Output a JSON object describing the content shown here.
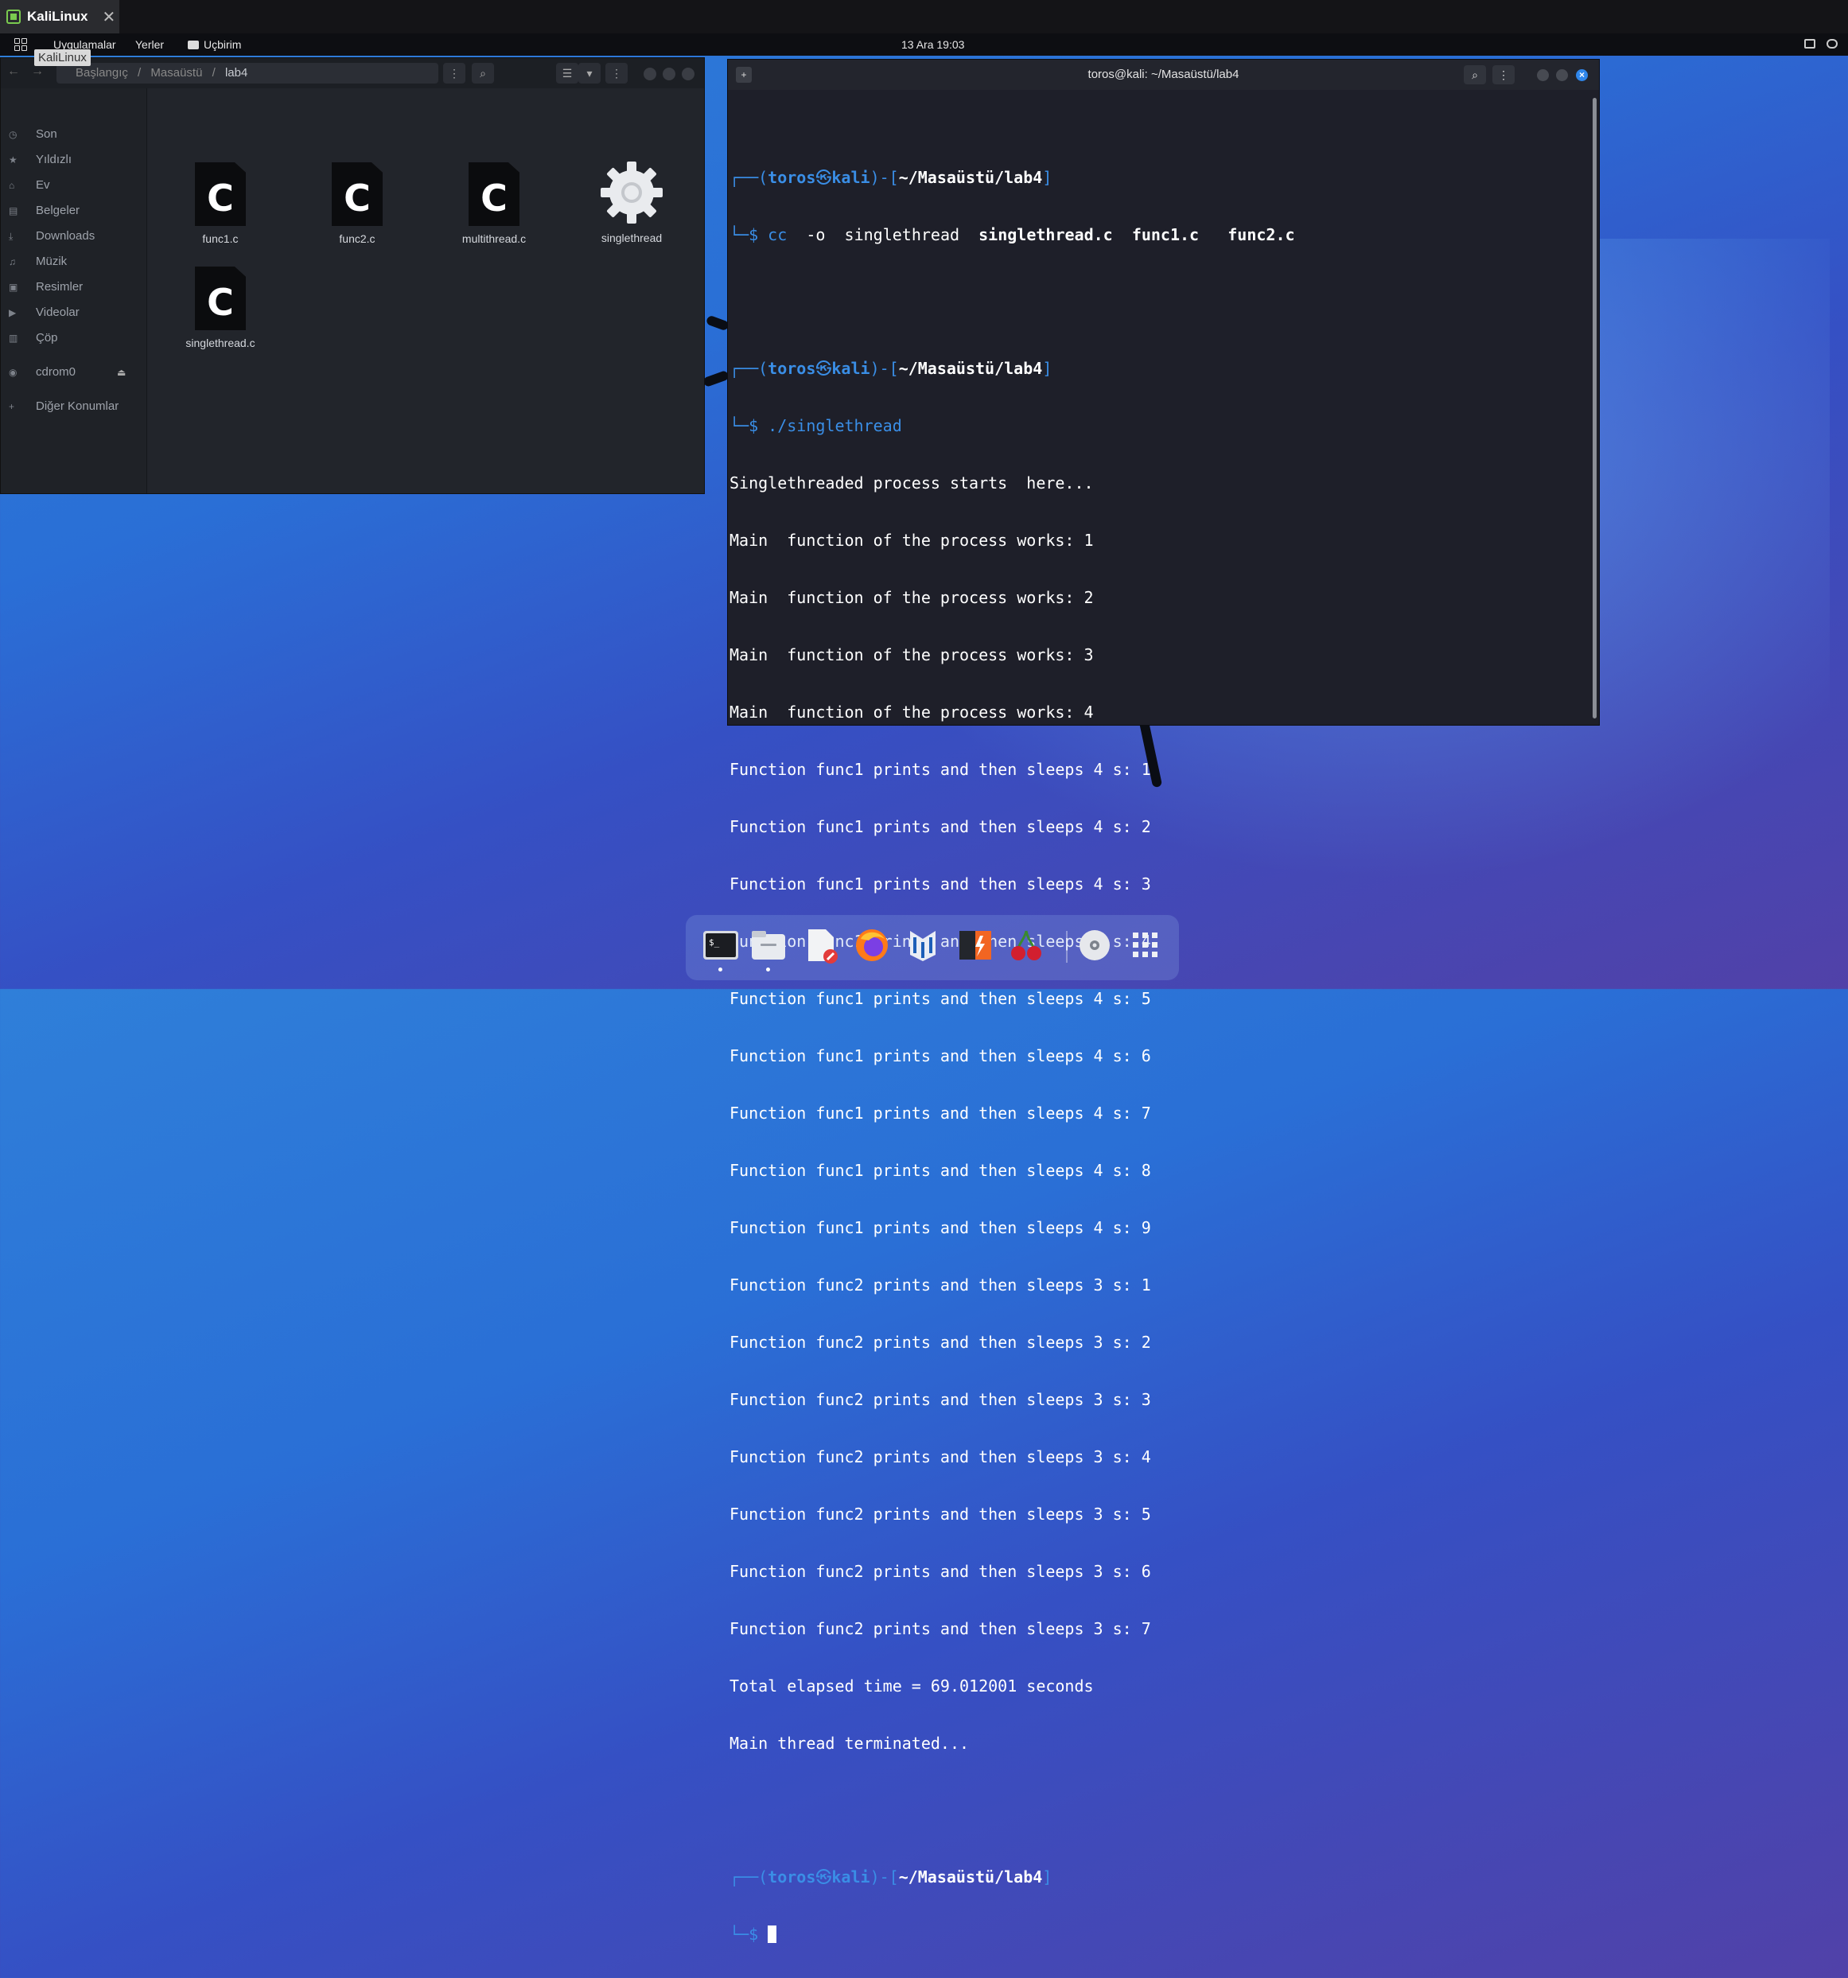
{
  "vm_tab": {
    "label": "KaliLinux",
    "close": "✕"
  },
  "panel": {
    "applications": "Uygulamalar",
    "places": "Yerler",
    "terminal": "Uçbirim",
    "clock": "13 Ara  19:03",
    "tooltip": "KaliLinux"
  },
  "file_manager": {
    "path": [
      "Başlangıç",
      "/",
      "Masaüstü",
      "/",
      "lab4"
    ],
    "sidebar": [
      {
        "label": "Son",
        "icon": "clock-icon"
      },
      {
        "label": "Yıldızlı",
        "icon": "star-icon"
      },
      {
        "label": "Ev",
        "icon": "home-icon"
      },
      {
        "label": "Belgeler",
        "icon": "document-icon"
      },
      {
        "label": "Downloads",
        "icon": "download-icon"
      },
      {
        "label": "Müzik",
        "icon": "music-icon"
      },
      {
        "label": "Resimler",
        "icon": "image-icon"
      },
      {
        "label": "Videolar",
        "icon": "video-icon"
      },
      {
        "label": "Çöp",
        "icon": "trash-icon"
      },
      {
        "label": "cdrom0",
        "icon": "disc-icon"
      },
      {
        "label": "Diğer Konumlar",
        "icon": "plus-icon"
      }
    ],
    "files": [
      {
        "name": "func1.c",
        "type": "c-source"
      },
      {
        "name": "func2.c",
        "type": "c-source"
      },
      {
        "name": "multithread.c",
        "type": "c-source"
      },
      {
        "name": "singlethread",
        "type": "executable"
      },
      {
        "name": "singlethread.c",
        "type": "c-source"
      }
    ]
  },
  "terminal": {
    "title": "toros@kali: ~/Masaüstü/lab4",
    "prompt_user": "toros",
    "prompt_at": "㉿",
    "prompt_host": "kali",
    "prompt_dir": "~/Masaüstü/lab4",
    "cmd1": {
      "cmd": "cc",
      "args": [
        "-o",
        "singlethread"
      ],
      "bold_args": [
        "singlethread.c",
        "func1.c",
        "func2.c"
      ]
    },
    "cmd2": "./singlethread",
    "output": [
      "Singlethreaded process starts  here...",
      "Main  function of the process works: 1",
      "Main  function of the process works: 2",
      "Main  function of the process works: 3",
      "Main  function of the process works: 4",
      "Function func1 prints and then sleeps 4 s: 1",
      "Function func1 prints and then sleeps 4 s: 2",
      "Function func1 prints and then sleeps 4 s: 3",
      "Function func1 prints and then sleeps 4 s: 4",
      "Function func1 prints and then sleeps 4 s: 5",
      "Function func1 prints and then sleeps 4 s: 6",
      "Function func1 prints and then sleeps 4 s: 7",
      "Function func1 prints and then sleeps 4 s: 8",
      "Function func1 prints and then sleeps 4 s: 9",
      "Function func2 prints and then sleeps 3 s: 1",
      "Function func2 prints and then sleeps 3 s: 2",
      "Function func2 prints and then sleeps 3 s: 3",
      "Function func2 prints and then sleeps 3 s: 4",
      "Function func2 prints and then sleeps 3 s: 5",
      "Function func2 prints and then sleeps 3 s: 6",
      "Function func2 prints and then sleeps 3 s: 7",
      "Total elapsed time = 69.012001 seconds",
      "Main thread terminated..."
    ]
  },
  "dock": [
    "terminal-icon",
    "files-icon",
    "text-editor-icon",
    "firefox-icon",
    "metasploit-icon",
    "burpsuite-icon",
    "cherrytree-icon",
    "disc-icon",
    "app-grid-icon"
  ],
  "colors": {
    "accent": "#3a8ee6",
    "terminal_bg": "#1e1f29",
    "panel_bg": "#0d0e12"
  }
}
